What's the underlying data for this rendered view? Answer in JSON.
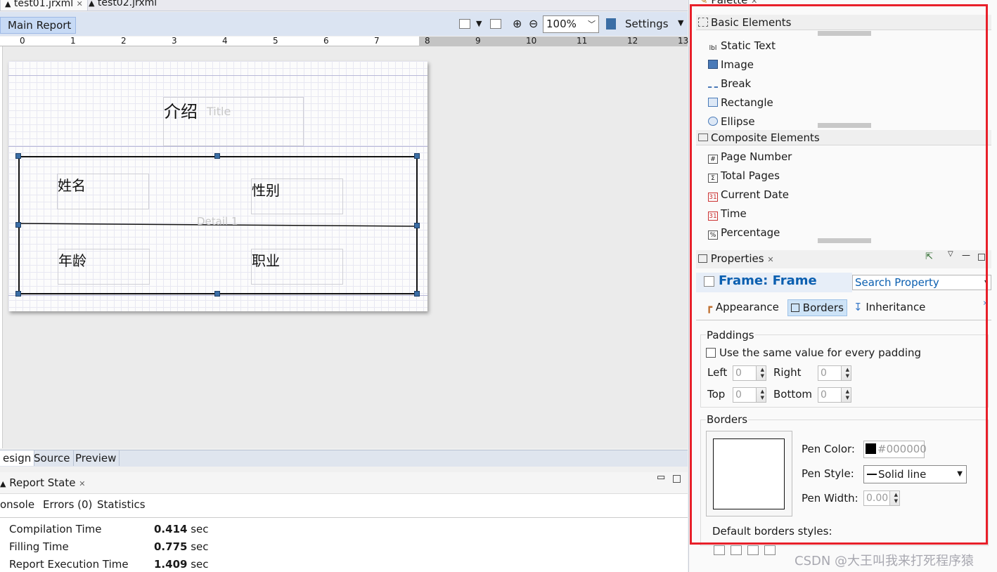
{
  "editor_tabs": [
    {
      "label": "test01.jrxml",
      "active": true
    },
    {
      "label": "test02.jrxml",
      "active": false
    }
  ],
  "toolbar": {
    "main_report": "Main Report",
    "zoom": "100%",
    "settings": "Settings"
  },
  "ruler": {
    "ticks": [
      "0",
      "1",
      "2",
      "3",
      "4",
      "5",
      "6",
      "7",
      "8",
      "9",
      "10",
      "11",
      "12",
      "13"
    ]
  },
  "report": {
    "title_text": "介绍",
    "title_band_label": "Title",
    "detail_band_label": "Detail 1",
    "fields": [
      "姓名",
      "性别",
      "年龄",
      "职业"
    ]
  },
  "bottom_tabs": {
    "design": "esign",
    "source": "Source",
    "preview": "Preview"
  },
  "report_state": {
    "title": "Report State",
    "tabs": {
      "console": "onsole",
      "errors": "Errors (0)",
      "statistics": "Statistics"
    },
    "stats": [
      {
        "label": "Compilation Time",
        "value": "0.414",
        "unit": "sec"
      },
      {
        "label": "Filling Time",
        "value": "0.775",
        "unit": "sec"
      },
      {
        "label": "Report Execution Time",
        "value": "1.409",
        "unit": "sec"
      }
    ]
  },
  "palette": {
    "title": "Palette",
    "basic_title": "Basic Elements",
    "basic_items": [
      "Static Text",
      "Image",
      "Break",
      "Rectangle",
      "Ellipse"
    ],
    "composite_title": "Composite Elements",
    "composite_items": [
      "Page Number",
      "Total Pages",
      "Current Date",
      "Time",
      "Percentage"
    ]
  },
  "properties": {
    "title": "Properties",
    "frame_title": "Frame: Frame",
    "search_placeholder": "Search Property",
    "tabs": {
      "appearance": "Appearance",
      "borders": "Borders",
      "inheritance": "Inheritance"
    },
    "paddings": {
      "title": "Paddings",
      "same_value_label": "Use the same value for every padding",
      "left_label": "Left",
      "left_value": "0",
      "right_label": "Right",
      "right_value": "0",
      "top_label": "Top",
      "top_value": "0",
      "bottom_label": "Bottom",
      "bottom_value": "0"
    },
    "borders": {
      "title": "Borders",
      "pen_color_label": "Pen Color:",
      "pen_color_value": "#000000",
      "pen_style_label": "Pen Style:",
      "pen_style_value": "Solid line",
      "pen_width_label": "Pen Width:",
      "pen_width_value": "0.00",
      "default_styles_label": "Default borders styles:"
    }
  },
  "watermark": "CSDN @大王叫我来打死程序猿",
  "colors": {
    "highlight_border": "#e8202a",
    "frame_title": "#0b5fb0",
    "handle": "#3b6ea5"
  }
}
